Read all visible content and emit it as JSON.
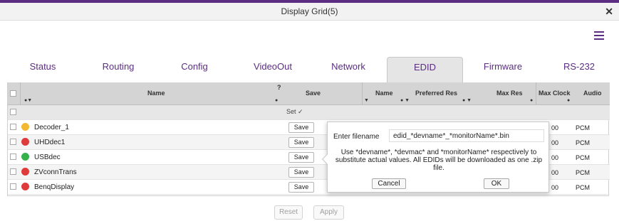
{
  "window": {
    "title": "Display Grid(5)",
    "close_glyph": "✕"
  },
  "menu_icon": "hamburger-icon",
  "tabs": [
    {
      "label": "Status",
      "active": false
    },
    {
      "label": "Routing",
      "active": false
    },
    {
      "label": "Config",
      "active": false
    },
    {
      "label": "VideoOut",
      "active": false
    },
    {
      "label": "Network",
      "active": false
    },
    {
      "label": "EDID",
      "active": true
    },
    {
      "label": "Firmware",
      "active": false
    },
    {
      "label": "RS-232",
      "active": false
    }
  ],
  "grid": {
    "columns": {
      "name": "Name",
      "question": "?",
      "save": "Save",
      "edid_name": "Name",
      "preferred_res": "Preferred Res",
      "max_res": "Max Res",
      "max_clock": "Max Clock",
      "audio": "Audio"
    },
    "set_label": "Set ✓",
    "rows": [
      {
        "name": "Decoder_1",
        "status": "yellow",
        "save": "Save",
        "max_clock": "00",
        "audio": "PCM"
      },
      {
        "name": "UHDdec1",
        "status": "red",
        "save": "Save",
        "max_clock": "00",
        "audio": "PCM"
      },
      {
        "name": "USBdec",
        "status": "green",
        "save": "Save",
        "max_clock": "00",
        "audio": "PCM"
      },
      {
        "name": "ZVconnTrans",
        "status": "red",
        "save": "Save",
        "max_clock": "00",
        "audio": "PCM"
      },
      {
        "name": "BenqDisplay",
        "status": "red",
        "save": "Save",
        "max_clock": "00",
        "audio": "PCM"
      }
    ]
  },
  "popup": {
    "label": "Enter filename",
    "value": "edid_*devname*_*monitorName*.bin",
    "help": "Use *devname*, *devmac* and *monitorName* respectively to substitute actual values. All EDIDs will be downloaded as one .zip file.",
    "cancel": "Cancel",
    "ok": "OK"
  },
  "footer": {
    "reset": "Reset",
    "apply": "Apply"
  },
  "colors": {
    "accent": "#5b2d83",
    "status_yellow": "#f4b731",
    "status_red": "#e03b3b",
    "status_green": "#35b24a"
  }
}
